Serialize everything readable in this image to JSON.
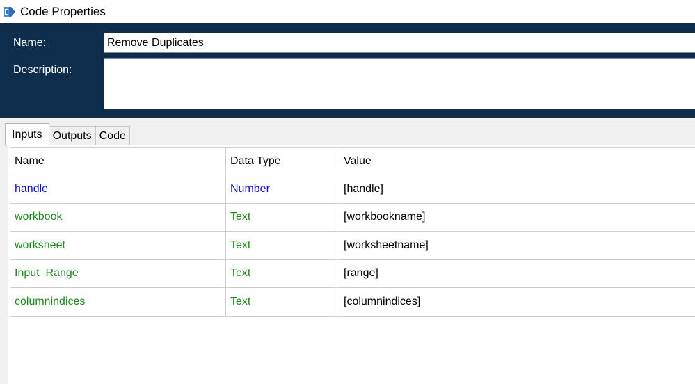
{
  "window": {
    "title": "Code Properties",
    "icon": "code-stage-icon"
  },
  "form": {
    "name_label": "Name:",
    "name_value": "Remove Duplicates",
    "description_label": "Description:",
    "description_value": ""
  },
  "tabs": [
    {
      "label": "Inputs",
      "active": true
    },
    {
      "label": "Outputs",
      "active": false
    },
    {
      "label": "Code",
      "active": false
    }
  ],
  "grid": {
    "columns": [
      "Name",
      "Data Type",
      "Value"
    ],
    "rows": [
      {
        "name": "handle",
        "type": "Number",
        "value": "[handle]"
      },
      {
        "name": "workbook",
        "type": "Text",
        "value": "[workbookname]"
      },
      {
        "name": "worksheet",
        "type": "Text",
        "value": "[worksheetname]"
      },
      {
        "name": "Input_Range",
        "type": "Text",
        "value": "[range]"
      },
      {
        "name": "columnindices",
        "type": "Text",
        "value": "[columnindices]"
      }
    ]
  },
  "colors": {
    "header_panel": "#0f2d4d",
    "number_type": "#1010d8",
    "text_type": "#1e8a1e"
  }
}
